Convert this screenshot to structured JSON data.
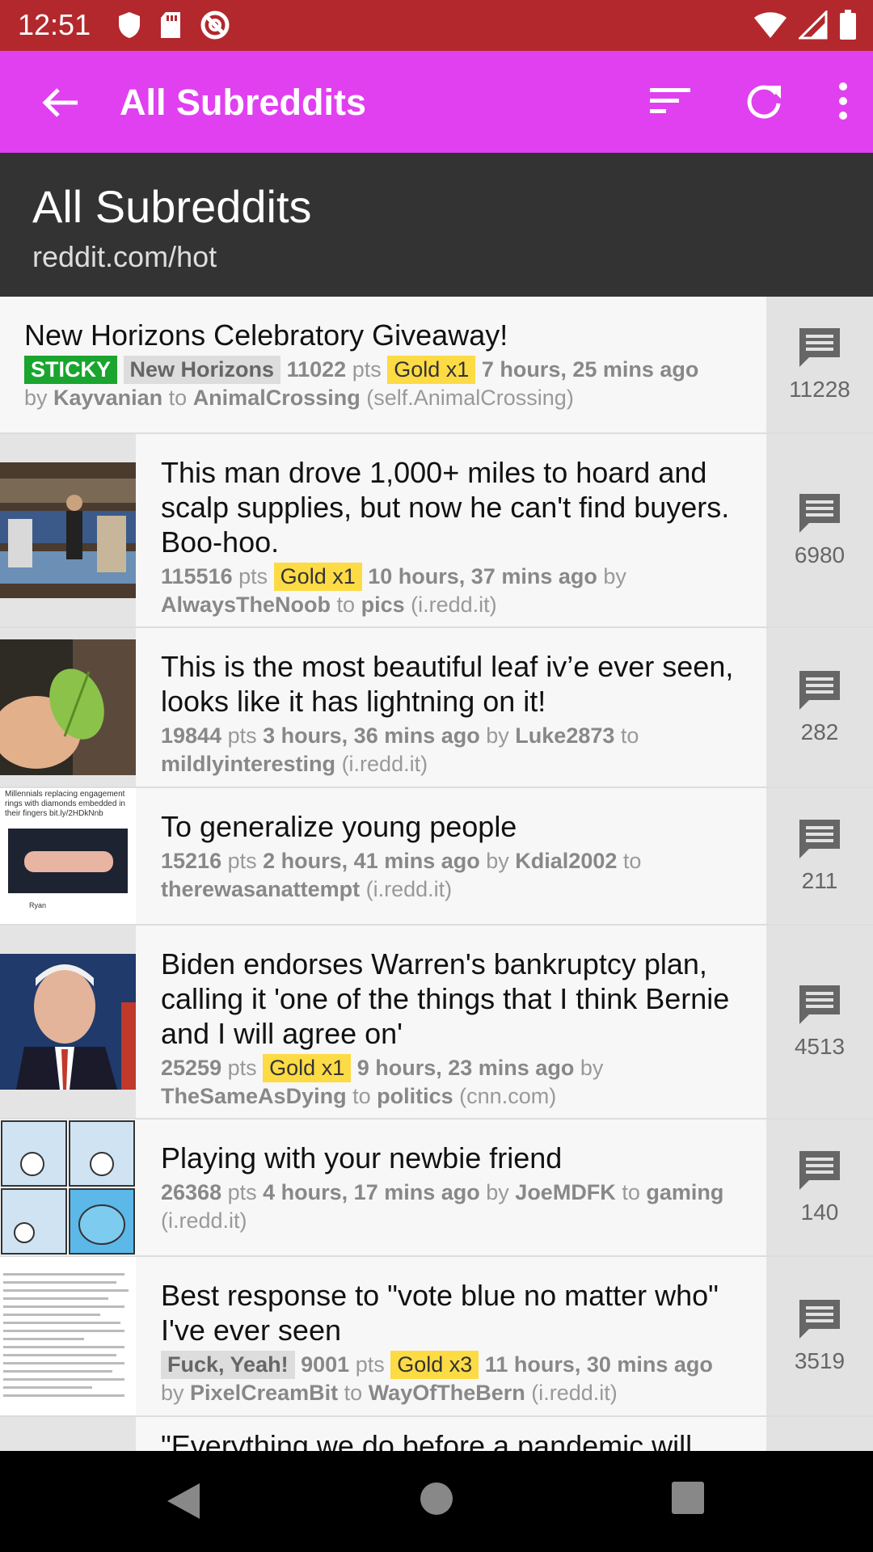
{
  "status": {
    "time": "12:51"
  },
  "appbar": {
    "title": "All Subreddits"
  },
  "header": {
    "title": "All Subreddits",
    "subtitle": "reddit.com/hot"
  },
  "posts": [
    {
      "title": "New Horizons Celebratory Giveaway!",
      "sticky": "STICKY",
      "flair": "New Horizons",
      "points": "11022",
      "pts": "pts",
      "gold": "Gold x1",
      "age": "7 hours, 25 mins ago",
      "by": "by",
      "author": "Kayvanian",
      "to": "to",
      "subreddit": "AnimalCrossing",
      "domain": "(self.AnimalCrossing)",
      "comments": "11228"
    },
    {
      "title": "This man drove 1,000+ miles to hoard and scalp supplies, but now he can't find buyers. Boo-hoo.",
      "points": "115516",
      "pts": "pts",
      "gold": "Gold x1",
      "age": "10 hours, 37 mins ago",
      "by": "by",
      "author": "AlwaysTheNoob",
      "to": "to",
      "subreddit": "pics",
      "domain": "(i.redd.it)",
      "comments": "6980"
    },
    {
      "title": "This is the most beautiful leaf iv’e ever seen, looks like it has lightning on it!",
      "points": "19844",
      "pts": "pts",
      "age": "3 hours, 36 mins ago",
      "by": "by",
      "author": "Luke2873",
      "to": "to",
      "subreddit": "mildlyinteresting",
      "domain": "(i.redd.it)",
      "comments": "282"
    },
    {
      "title": "To generalize young people",
      "points": "15216",
      "pts": "pts",
      "age": "2 hours, 41 mins ago",
      "by": "by",
      "author": "Kdial2002",
      "to": "to",
      "subreddit": "therewasanattempt",
      "domain": "(i.redd.it)",
      "comments": "211",
      "thumb_text": "Millennials replacing engagement rings with diamonds embedded in their fingers bit.ly/2HDkNnb",
      "thumb_handle": "Ryan"
    },
    {
      "title": "Biden endorses Warren's bankruptcy plan, calling it 'one of the things that I think Bernie and I will agree on'",
      "points": "25259",
      "pts": "pts",
      "gold": "Gold x1",
      "age": "9 hours, 23 mins ago",
      "by": "by",
      "author": "TheSameAsDying",
      "to": "to",
      "subreddit": "politics",
      "domain": "(cnn.com)",
      "comments": "4513"
    },
    {
      "title": "Playing with your newbie friend",
      "points": "26368",
      "pts": "pts",
      "age": "4 hours, 17 mins ago",
      "by": "by",
      "author": "JoeMDFK",
      "to": "to",
      "subreddit": "gaming",
      "domain": "(i.redd.it)",
      "comments": "140"
    },
    {
      "title": "Best response to \"vote blue no matter who\" I've ever seen",
      "flair": "Fuck, Yeah!",
      "points": "9001",
      "pts": "pts",
      "gold": "Gold x3",
      "age": "11 hours, 30 mins ago",
      "by": "by",
      "author": "PixelCreamBit",
      "to": "to",
      "subreddit": "WayOfTheBern",
      "domain": "(i.redd.it)",
      "comments": "3519"
    },
    {
      "title": "\"Everything we do before a pandemic will"
    }
  ]
}
